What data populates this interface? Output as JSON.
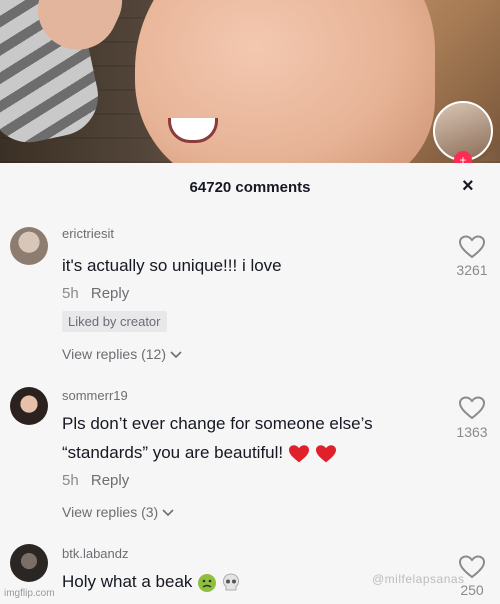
{
  "sheet": {
    "title": "64720 comments",
    "close": "×"
  },
  "comments": [
    {
      "user": "erictriesit",
      "text": "it's actually so unique!!! i love",
      "time": "5h",
      "reply": "Reply",
      "liked_by_creator": "Liked by creator",
      "view_replies": "View replies (12)",
      "likes": "3261"
    },
    {
      "user": "sommerr19",
      "text_line1": "Pls don’t ever change for someone else’s",
      "text_line2": "“standards” you are beautiful!",
      "time": "5h",
      "reply": "Reply",
      "view_replies": "View replies (3)",
      "likes": "1363"
    },
    {
      "user": "btk.labandz",
      "text": "Holy what a beak",
      "likes": "250"
    }
  ],
  "live_badge": "+",
  "watermarks": {
    "imgflip": "imgflip.com",
    "tiktok": "@milfelapsanas"
  },
  "colors": {
    "accent": "#fe2c55",
    "text": "#161823",
    "muted": "#8a8a8f",
    "background": "#f6f6f6"
  },
  "icons": [
    "heart-icon",
    "close-icon",
    "chevron-down-icon",
    "red-heart-emoji",
    "nauseated-face-emoji",
    "skull-emoji"
  ]
}
